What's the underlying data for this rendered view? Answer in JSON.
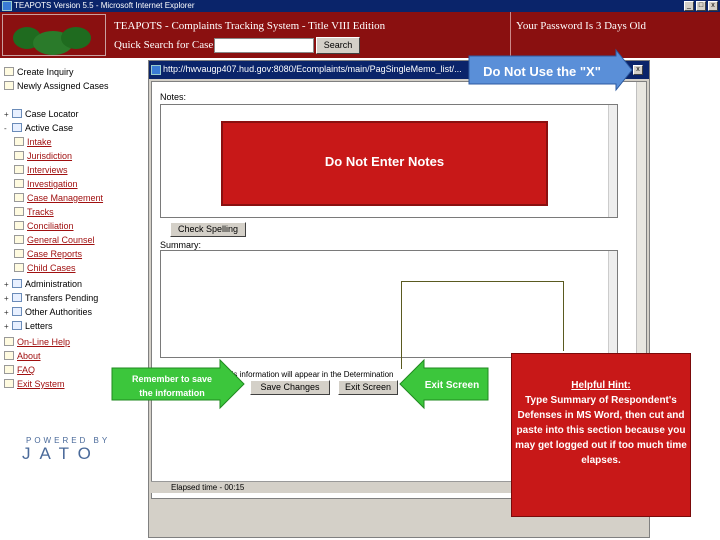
{
  "ie_window": {
    "title": "TEAPOTS Version 5.5 - Microsoft Internet Explorer",
    "min": "_",
    "max": "□",
    "close": "x"
  },
  "header": {
    "app_name": "TEAPOTS - Complaints Tracking System - Title VIII Edition",
    "quick_search_label": "Quick Search for Case",
    "quick_search_value": "",
    "search_button": "Search",
    "password_note": "Your Password Is 3 Days Old"
  },
  "sidebar": {
    "top_items": [
      {
        "label": "Create Inquiry"
      },
      {
        "label": "Newly Assigned Cases"
      }
    ],
    "tree": [
      {
        "exp": "+",
        "label": "Case Locator"
      },
      {
        "exp": "-",
        "label": "Active Case"
      }
    ],
    "sub_items": [
      {
        "label": "Intake"
      },
      {
        "label": "Jurisdiction"
      },
      {
        "label": "Interviews"
      },
      {
        "label": "Investigation"
      },
      {
        "label": "Case Management"
      },
      {
        "label": "Tracks"
      },
      {
        "label": "Conciliation"
      },
      {
        "label": "General Counsel"
      },
      {
        "label": "Case Reports"
      },
      {
        "label": "Child Cases"
      }
    ],
    "tree2": [
      {
        "exp": "+",
        "label": "Administration"
      },
      {
        "exp": "+",
        "label": "Transfers Pending"
      },
      {
        "exp": "+",
        "label": "Other Authorities"
      },
      {
        "exp": "+",
        "label": "Letters"
      }
    ],
    "links": [
      {
        "label": "On-Line Help"
      },
      {
        "label": "About"
      },
      {
        "label": "FAQ"
      },
      {
        "label": "Exit System"
      }
    ],
    "powered_by": "POWERED BY",
    "jato": "JATO"
  },
  "popup": {
    "url": "http://hwvaugp407.hud.gov:8080/Ecomplaints/main/PagSingleMemo_list/...",
    "notes_label": "Notes:",
    "check_spelling": "Check Spelling",
    "summary_label": "Summary:",
    "instructions": "INSTRUCTIONS: This information will appear in the Determination",
    "save_button": "Save Changes",
    "exit_button": "Exit Screen",
    "status": "Elapsed time - 00:15",
    "close": "x"
  },
  "overlays": {
    "do_not_use_x": "Do Not Use the \"X\"",
    "do_not_enter_notes": "Do Not Enter Notes",
    "remember_line1": "Remember to save",
    "remember_line2": "the information",
    "exit_screen": "Exit Screen",
    "hint_heading": "Helpful Hint:",
    "hint_body": "Type Summary of Respondent's Defenses in MS Word, then cut and paste into this section because you may get logged out if too much time elapses."
  },
  "colors": {
    "header_maroon": "#8a1010",
    "overlay_red": "#c81818",
    "arrow_green": "#3cc63c",
    "arrow_blue": "#5a8fd8",
    "title_navy": "#0a246a"
  }
}
